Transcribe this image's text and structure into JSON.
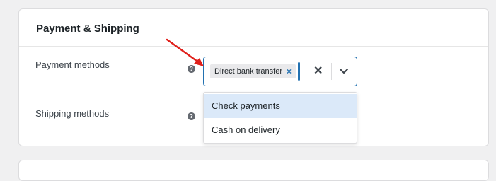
{
  "section": {
    "title": "Payment & Shipping"
  },
  "payment": {
    "label": "Payment methods",
    "help_icon": "?",
    "selected_chip": "Direct bank transfer",
    "chip_remove": "×",
    "clear": "✕"
  },
  "shipping": {
    "label": "Shipping methods",
    "help_icon": "?"
  },
  "dropdown": {
    "options": [
      "Check payments",
      "Cash on delivery"
    ]
  },
  "colors": {
    "accent": "#2271b1",
    "annotation_arrow": "#e0201b",
    "highlight": "#dbe9f9"
  },
  "icons": {
    "help": "question-circle-icon",
    "clear": "close-icon",
    "dropdown": "chevron-down-icon",
    "annotation": "red-arrow-icon"
  }
}
